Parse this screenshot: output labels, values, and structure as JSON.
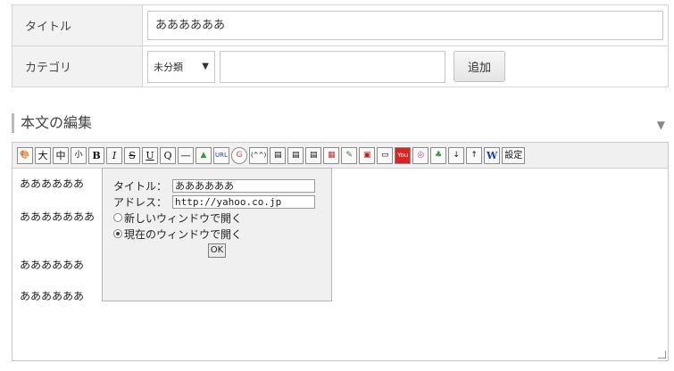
{
  "form": {
    "title_label": "タイトル",
    "title_value": "ああああああ",
    "category_label": "カテゴリ",
    "category_selected": "未分類",
    "category_input_value": "",
    "add_button_label": "追加"
  },
  "section": {
    "heading": "本文の編集",
    "toggle_icon": "▼"
  },
  "toolbar": {
    "buttons": [
      {
        "label": "🎨",
        "icon": "palette-icon"
      },
      {
        "label": "大"
      },
      {
        "label": "中"
      },
      {
        "label": "小"
      },
      {
        "label": "B"
      },
      {
        "label": "I"
      },
      {
        "label": "S"
      },
      {
        "label": "U"
      },
      {
        "label": "Q"
      },
      {
        "label": "—"
      },
      {
        "label": "▲",
        "icon": "image-icon"
      },
      {
        "label": "URL"
      },
      {
        "label": "G",
        "icon": "google-icon"
      },
      {
        "label": "(^^)"
      },
      {
        "label": "▤",
        "icon": "doc-icon"
      },
      {
        "label": "▤",
        "icon": "doc2-icon"
      },
      {
        "label": "▤",
        "icon": "doc3-icon"
      },
      {
        "label": "▦",
        "icon": "color-grid-icon"
      },
      {
        "label": "✎",
        "icon": "pen-icon"
      },
      {
        "label": "▣",
        "icon": "tv-icon"
      },
      {
        "label": "▭",
        "icon": "frame-icon"
      },
      {
        "label": "You",
        "icon": "youtube-icon"
      },
      {
        "label": "◎",
        "icon": "instagram-icon"
      },
      {
        "label": "♣",
        "icon": "evernote-icon"
      },
      {
        "label": "↓",
        "icon": "arrow-down-icon"
      },
      {
        "label": "↑",
        "icon": "arrow-up-icon"
      },
      {
        "label": "W",
        "icon": "word-icon"
      },
      {
        "label": "設定"
      }
    ]
  },
  "editor": {
    "lines": [
      "ああああああ",
      "あああああああ",
      "ああああああ",
      "ああああああ"
    ]
  },
  "popup": {
    "title_label": "タイトル：",
    "title_value": "ああああああ",
    "address_label": "アドレス：",
    "address_value": "http://yahoo.co.jp",
    "option_new_window": "新しいウィンドウで開く",
    "option_current_window": "現在のウィンドウで開く",
    "ok_label": "OK"
  }
}
